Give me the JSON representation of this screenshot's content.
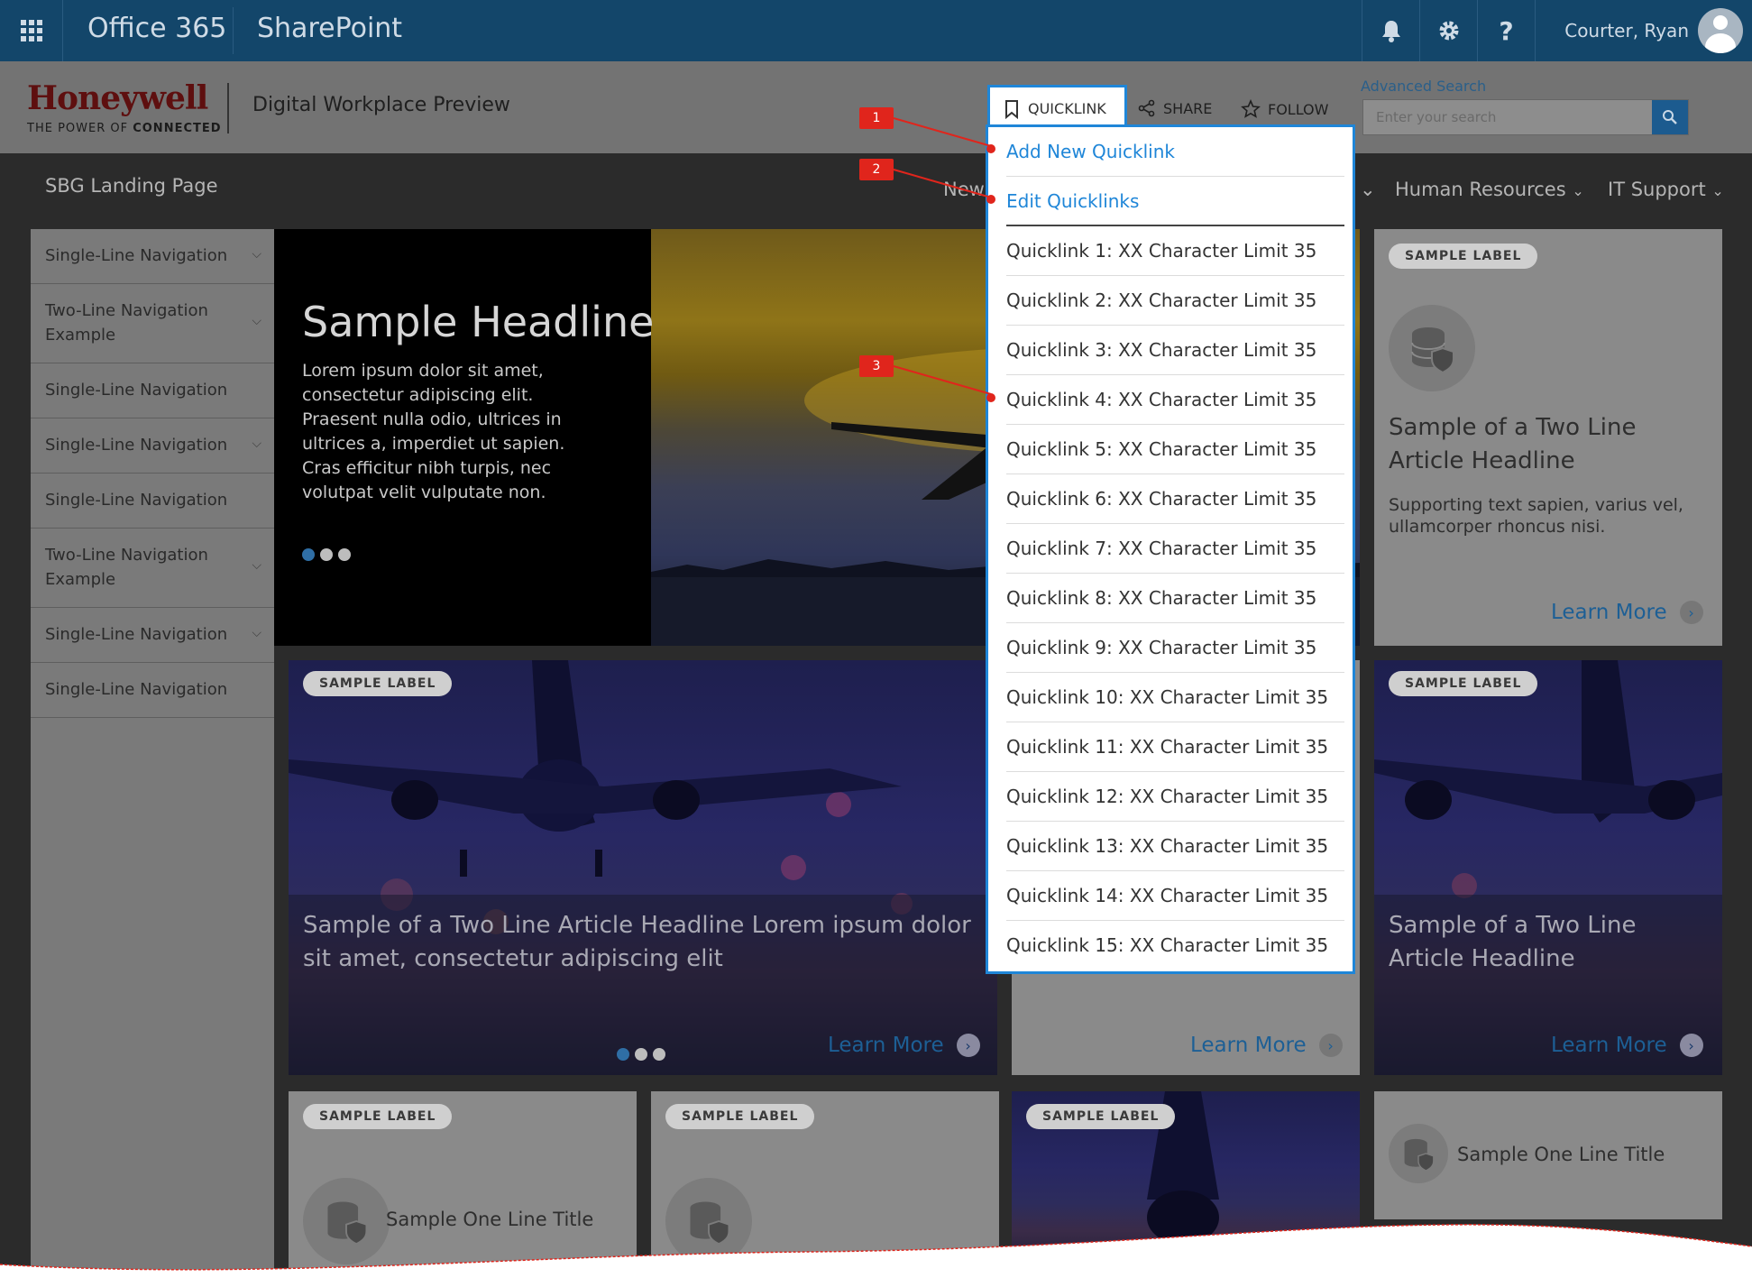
{
  "topbar": {
    "app_title": "Office 365",
    "product": "SharePoint",
    "user_name": "Courter, Ryan",
    "bell_icon": "bell-icon",
    "gear_icon": "gear-icon",
    "help_glyph": "?"
  },
  "header": {
    "logo_name": "Honeywell",
    "logo_tagline_prefix": "THE POWER OF",
    "logo_tagline_bold": "CONNECTED",
    "site_name": "Digital Workplace Preview",
    "quicklink_label": "QUICKLINK",
    "share_label": "SHARE",
    "follow_label": "FOLLOW",
    "advanced_search_label": "Advanced Search",
    "search_placeholder": "Enter your search"
  },
  "nav": {
    "landing": "SBG Landing Page",
    "partial_link": "New",
    "items": [
      "Human Resources",
      "IT Support"
    ]
  },
  "sidebar": {
    "items": [
      {
        "label_lines": [
          "Single-Line Navigation"
        ],
        "chevron": true
      },
      {
        "label_lines": [
          "Two-Line Navigation",
          "Example"
        ],
        "chevron": true
      },
      {
        "label_lines": [
          "Single-Line Navigation"
        ],
        "chevron": false
      },
      {
        "label_lines": [
          "Single-Line Navigation"
        ],
        "chevron": true
      },
      {
        "label_lines": [
          "Single-Line Navigation"
        ],
        "chevron": false
      },
      {
        "label_lines": [
          "Two-Line Navigation",
          "Example"
        ],
        "chevron": true
      },
      {
        "label_lines": [
          "Single-Line Navigation"
        ],
        "chevron": true
      },
      {
        "label_lines": [
          "Single-Line Navigation"
        ],
        "chevron": false
      }
    ]
  },
  "hero": {
    "headline": "Sample Headline",
    "body": "Lorem ipsum dolor sit amet, consectetur adipiscing elit. Praesent nulla odio, ultrices in ultrices a, imperdiet ut sapien. Cras efficitur nibh turpis, nec volutpat velit vulputate non.",
    "dots_total": 3,
    "active_dot": 1
  },
  "cards": {
    "label": "SAMPLE LABEL",
    "learn_more": "Learn More",
    "right_top_title_1": "Sample of a Two Line",
    "right_top_title_2": "Article Headline",
    "right_top_sub": "Supporting text sapien, varius vel, ullamcorper rhoncus nisi.",
    "wide_title_1": "Sample of a Two Line Article Headline Lorem ipsum dolor",
    "wide_title_2": "sit amet, consectetur adipiscing elit",
    "right_mid_title_1": "Sample of a Two Line",
    "right_mid_title_2": "Article Headline",
    "one_line_title": "Sample One Line Title"
  },
  "quicklink_menu": {
    "add_new": "Add New Quicklink",
    "edit": "Edit Quicklinks",
    "items": [
      "Quicklink 1: XX Character Limit 35",
      "Quicklink 2: XX Character Limit 35",
      "Quicklink 3: XX Character Limit 35",
      "Quicklink 4: XX Character Limit 35",
      "Quicklink 5: XX Character Limit 35",
      "Quicklink 6: XX Character Limit 35",
      "Quicklink 7: XX Character Limit 35",
      "Quicklink 8: XX Character Limit 35",
      "Quicklink 9: XX Character Limit 35",
      "Quicklink 10: XX Character Limit 35",
      "Quicklink 11: XX Character Limit 35",
      "Quicklink 12: XX Character Limit 35",
      "Quicklink 13: XX Character Limit 35",
      "Quicklink 14: XX Character Limit 35",
      "Quicklink 15: XX Character Limit 35"
    ]
  },
  "annotations": [
    "1",
    "2",
    "3"
  ],
  "colors": {
    "o365_bar": "#13466a",
    "accent_blue": "#1f86d8",
    "annotation_red": "#e0251c",
    "link_blue": "#1d5f95"
  }
}
